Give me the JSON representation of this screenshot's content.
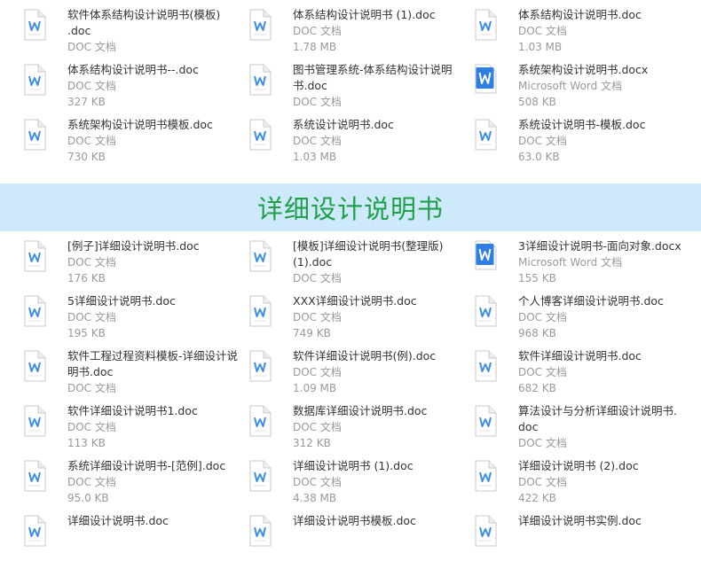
{
  "top_files": [
    {
      "name": "软件体系结构设计说明书(模板)\n.doc",
      "type": "DOC 文档",
      "size": "",
      "icon": "doc-file-icon"
    },
    {
      "name": "体系结构设计说明书 (1).doc",
      "type": "DOC 文档",
      "size": "1.78 MB",
      "icon": "doc-file-icon"
    },
    {
      "name": "体系结构设计说明书.doc",
      "type": "DOC 文档",
      "size": "1.03 MB",
      "icon": "doc-file-icon"
    },
    {
      "name": "体系结构设计说明书--.doc",
      "type": "DOC 文档",
      "size": "327 KB",
      "icon": "doc-file-icon"
    },
    {
      "name": "图书管理系统-体系结构设计说明\n书.doc",
      "type": "DOC 文档",
      "size": "",
      "icon": "doc-file-icon"
    },
    {
      "name": "系统架构设计说明书.docx",
      "type": "Microsoft Word 文档",
      "size": "508 KB",
      "icon": "docx-file-icon"
    },
    {
      "name": "系统架构设计说明书模板.doc",
      "type": "DOC 文档",
      "size": "730 KB",
      "icon": "doc-file-icon"
    },
    {
      "name": "系统设计说明书.doc",
      "type": "DOC 文档",
      "size": "1.03 MB",
      "icon": "doc-file-icon"
    },
    {
      "name": "系统设计说明书-模板.doc",
      "type": "DOC 文档",
      "size": "63.0 KB",
      "icon": "doc-file-icon"
    }
  ],
  "section": {
    "title": "详细设计说明书"
  },
  "bottom_files": [
    {
      "name": "[例子]详细设计说明书.doc",
      "type": "DOC 文档",
      "size": "176 KB",
      "icon": "doc-file-icon"
    },
    {
      "name": "[模板]详细设计说明书(整理版)\n(1).doc",
      "type": "DOC 文档",
      "size": "",
      "icon": "doc-file-icon"
    },
    {
      "name": "3详细设计说明书-面向对象.docx",
      "type": "Microsoft Word 文档",
      "size": "155 KB",
      "icon": "docx-file-icon"
    },
    {
      "name": "5详细设计说明书.doc",
      "type": "DOC 文档",
      "size": "195 KB",
      "icon": "doc-file-icon"
    },
    {
      "name": "XXX详细设计说明书.doc",
      "type": "DOC 文档",
      "size": "749 KB",
      "icon": "doc-file-icon"
    },
    {
      "name": "个人博客详细设计说明书.doc",
      "type": "DOC 文档",
      "size": "968 KB",
      "icon": "doc-file-icon"
    },
    {
      "name": "软件工程过程资料模板-详细设计说\n明书.doc",
      "type": "DOC 文档",
      "size": "",
      "icon": "doc-file-icon"
    },
    {
      "name": "软件详细设计说明书(例).doc",
      "type": "DOC 文档",
      "size": "1.09 MB",
      "icon": "doc-file-icon"
    },
    {
      "name": "软件详细设计说明书.doc",
      "type": "DOC 文档",
      "size": "682 KB",
      "icon": "doc-file-icon"
    },
    {
      "name": "软件详细设计说明书1.doc",
      "type": "DOC 文档",
      "size": "113 KB",
      "icon": "doc-file-icon"
    },
    {
      "name": "数据库详细设计说明书.doc",
      "type": "DOC 文档",
      "size": "312 KB",
      "icon": "doc-file-icon"
    },
    {
      "name": "算法设计与分析详细设计说明书.\ndoc",
      "type": "DOC 文档",
      "size": "",
      "icon": "doc-file-icon"
    },
    {
      "name": "系统详细设计说明书-[范例].doc",
      "type": "DOC 文档",
      "size": "95.0 KB",
      "icon": "doc-file-icon"
    },
    {
      "name": "详细设计说明书 (1).doc",
      "type": "DOC 文档",
      "size": "4.38 MB",
      "icon": "doc-file-icon"
    },
    {
      "name": "详细设计说明书 (2).doc",
      "type": "DOC 文档",
      "size": "422 KB",
      "icon": "doc-file-icon"
    },
    {
      "name": "详细设计说明书.doc",
      "type": "",
      "size": "",
      "icon": "doc-file-icon"
    },
    {
      "name": "详细设计说明书模板.doc",
      "type": "",
      "size": "",
      "icon": "doc-file-icon"
    },
    {
      "name": "详细设计说明书实例.doc",
      "type": "",
      "size": "",
      "icon": "doc-file-icon"
    }
  ],
  "colors": {
    "banner_bg": "#cde9fb",
    "banner_text": "#21a04a",
    "doc_blue": "#3d8ee8",
    "docx_blue": "#2f7fe3"
  }
}
